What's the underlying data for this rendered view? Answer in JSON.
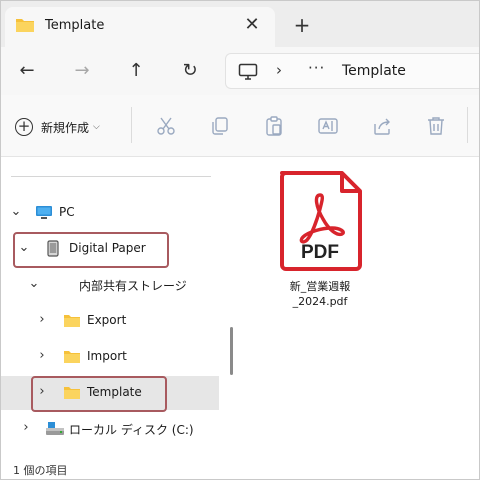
{
  "tab": {
    "title": "Template",
    "close_glyph": "✕",
    "new_glyph": "+"
  },
  "nav": {
    "back_glyph": "←",
    "forward_glyph": "→",
    "up_glyph": "↑",
    "refresh_glyph": "↻"
  },
  "address": {
    "chevron": "›",
    "more": "···",
    "crumb": "Template"
  },
  "commandbar": {
    "new_label": "新規作成",
    "new_caret": "⌵",
    "icons": [
      "cut-icon",
      "copy-icon",
      "paste-icon",
      "rename-icon",
      "share-icon",
      "delete-icon"
    ]
  },
  "navpane": {
    "items": [
      {
        "label": "PC",
        "chevron": "⌄",
        "icon": "pc-icon"
      },
      {
        "label": "Digital Paper",
        "chevron": "⌄",
        "icon": "device-icon"
      },
      {
        "label": "内部共有ストレージ",
        "chevron": "⌄",
        "icon": ""
      },
      {
        "label": "Export",
        "chevron": "›",
        "icon": "folder-icon"
      },
      {
        "label": "Import",
        "chevron": "›",
        "icon": "folder-icon"
      },
      {
        "label": "Template",
        "chevron": "›",
        "icon": "folder-icon"
      },
      {
        "label": "ローカル ディスク (C:)",
        "chevron": "›",
        "icon": "drive-icon"
      }
    ]
  },
  "content": {
    "files": [
      {
        "name_line1": "新_営業週報",
        "name_line2": "_2024.pdf",
        "icon_label": "PDF"
      }
    ]
  },
  "status": {
    "text": "1 個の項目"
  },
  "colors": {
    "highlight": "#a85a5f",
    "pdf_red": "#d8242c",
    "folder_yellow": "#f6c13a"
  }
}
